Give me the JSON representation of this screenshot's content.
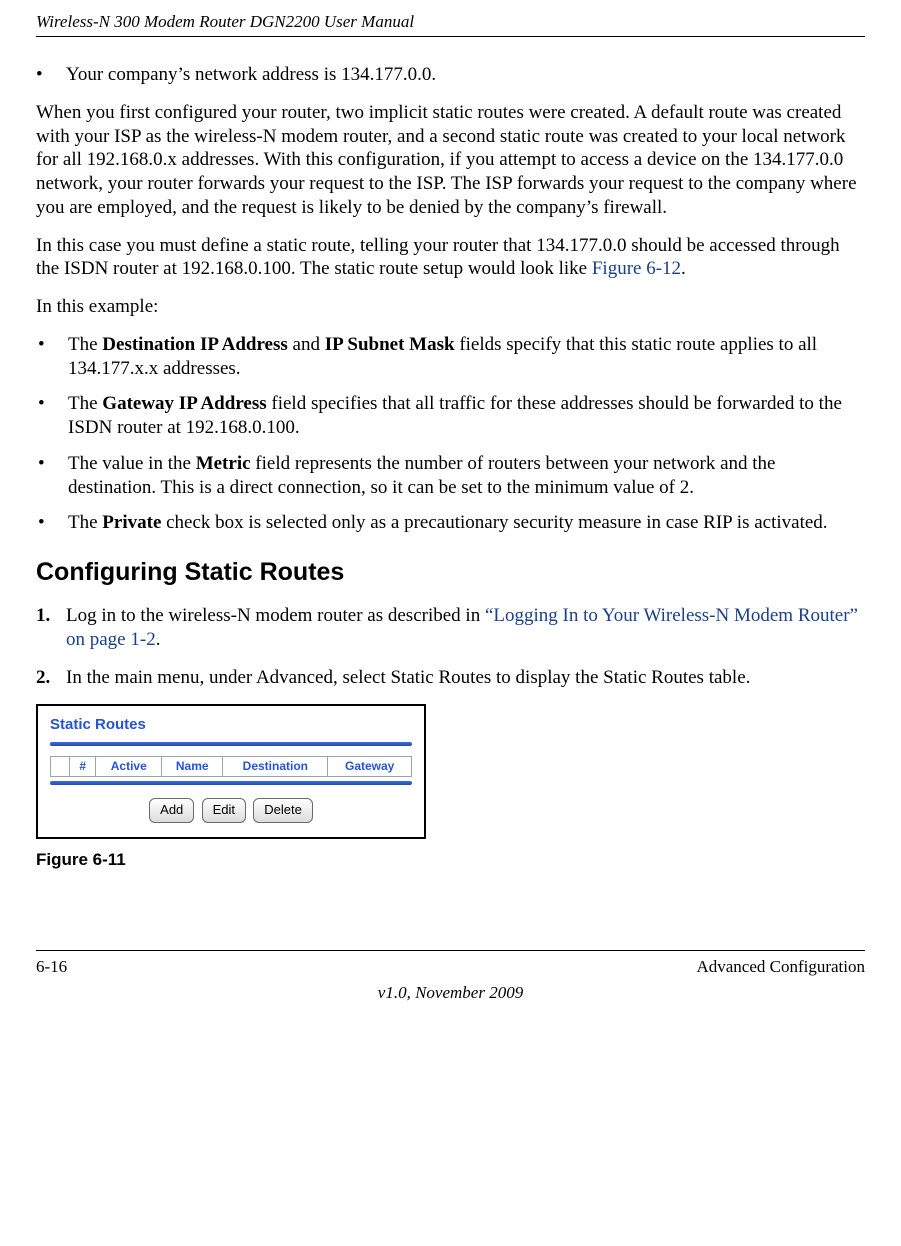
{
  "header": {
    "title": "Wireless-N 300 Modem Router DGN2200 User Manual"
  },
  "intro_bullet": {
    "marker": "•",
    "text": "Your company’s network address is 134.177.0.0."
  },
  "para1": "When you first configured your router, two implicit static routes were created. A default route was created with your ISP as the wireless-N modem router, and a second static route was created to your local network for all 192.168.0.x addresses. With this configuration, if you attempt to access a device on the 134.177.0.0 network, your router forwards your request to the ISP. The ISP forwards your request to the company where you are employed, and the request is likely to be denied by the company’s firewall.",
  "para2_pre": "In this case you must define a static route, telling your router that 134.177.0.0 should be accessed through the ISDN router at 192.168.0.100. The static route setup would look like ",
  "para2_link": "Figure 6-12",
  "para2_post": ".",
  "para3": "In this example:",
  "example_bullets": [
    {
      "marker": "•",
      "pre": "The ",
      "b1": "Destination IP Address",
      "mid1": " and ",
      "b2": "IP Subnet Mask",
      "post": " fields specify that this static route applies to all 134.177.x.x addresses."
    },
    {
      "marker": "•",
      "pre": "The ",
      "b1": "Gateway IP Address",
      "mid1": "",
      "b2": "",
      "post": " field specifies that all traffic for these addresses should be forwarded to the ISDN router at 192.168.0.100."
    },
    {
      "marker": "•",
      "pre": "The value in the ",
      "b1": "Metric",
      "mid1": "",
      "b2": "",
      "post": " field represents the number of routers between your network and the destination. This is a direct connection, so it can be set to the minimum value of 2."
    },
    {
      "marker": "•",
      "pre": "The ",
      "b1": "Private",
      "mid1": "",
      "b2": "",
      "post": " check box is selected only as a precautionary security measure in case RIP is activated."
    }
  ],
  "section_heading": "Configuring Static Routes",
  "steps": [
    {
      "num": "1.",
      "pre": "Log in to the wireless-N modem router as described in ",
      "link": "“Logging In to Your Wireless-N Modem Router” on page 1-2",
      "post": "."
    },
    {
      "num": "2.",
      "pre": "In the main menu, under Advanced, select Static Routes to display the Static Routes table.",
      "link": "",
      "post": ""
    }
  ],
  "screenshot": {
    "title": "Static Routes",
    "columns": [
      "#",
      "Active",
      "Name",
      "Destination",
      "Gateway"
    ],
    "buttons": {
      "add": "Add",
      "edit": "Edit",
      "delete": "Delete"
    }
  },
  "figure_caption": "Figure 6-11",
  "footer": {
    "left": "6-16",
    "right": "Advanced Configuration",
    "center": "v1.0, November 2009"
  }
}
